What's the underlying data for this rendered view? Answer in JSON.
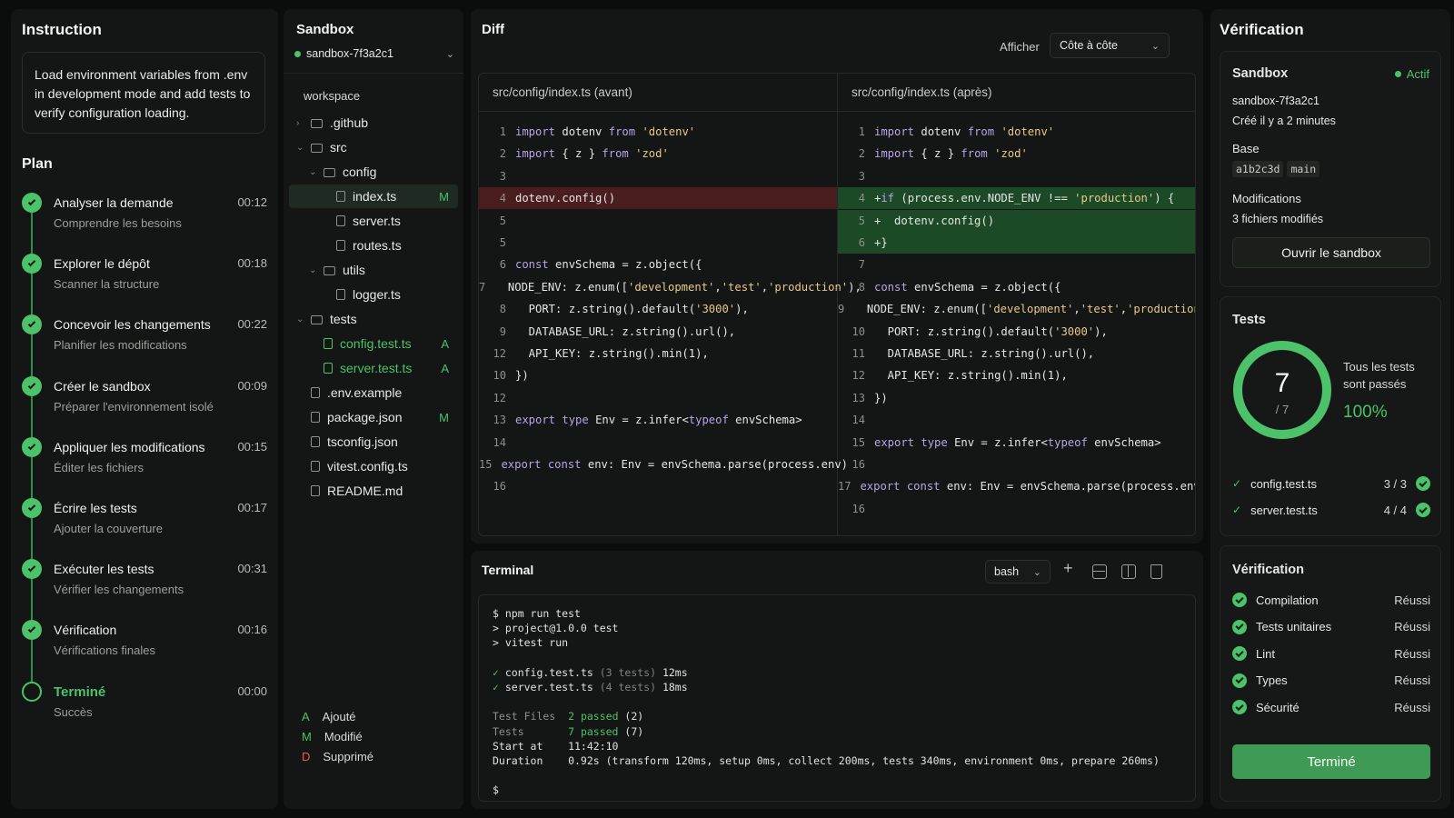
{
  "instruction": {
    "title": "Instruction",
    "text": "Load environment variables from .env in development mode and add tests to verify configuration loading."
  },
  "plan": {
    "title": "Plan",
    "steps": [
      {
        "title": "Analyser la demande",
        "sub": "Comprendre les besoins",
        "time": "00:12"
      },
      {
        "title": "Explorer le dépôt",
        "sub": "Scanner la structure",
        "time": "00:18"
      },
      {
        "title": "Concevoir les changements",
        "sub": "Planifier les modifications",
        "time": "00:22"
      },
      {
        "title": "Créer le sandbox",
        "sub": "Préparer l'environnement isolé",
        "time": "00:09"
      },
      {
        "title": "Appliquer les modifications",
        "sub": "Éditer les fichiers",
        "time": "00:15"
      },
      {
        "title": "Écrire les tests",
        "sub": "Ajouter la couverture",
        "time": "00:17"
      },
      {
        "title": "Exécuter les tests",
        "sub": "Vérifier les changements",
        "time": "00:31"
      },
      {
        "title": "Vérification",
        "sub": "Vérifications finales",
        "time": "00:16"
      },
      {
        "title": "Terminé",
        "sub": "Succès",
        "time": "00:00"
      }
    ]
  },
  "sandbox": {
    "title": "Sandbox",
    "name": "sandbox-7f3a2c1",
    "root": "workspace",
    "tree": [
      {
        "name": ".github",
        "kind": "folder",
        "chev": "›"
      },
      {
        "name": "src",
        "kind": "folder",
        "chev": "⌄"
      },
      {
        "name": "config",
        "kind": "folder",
        "chev": "⌄"
      },
      {
        "name": "index.ts",
        "kind": "file",
        "badge": "M"
      },
      {
        "name": "server.ts",
        "kind": "file"
      },
      {
        "name": "routes.ts",
        "kind": "file"
      },
      {
        "name": "utils",
        "kind": "folder",
        "chev": "⌄"
      },
      {
        "name": "logger.ts",
        "kind": "file"
      },
      {
        "name": "tests",
        "kind": "folder",
        "chev": "⌄"
      },
      {
        "name": "config.test.ts",
        "kind": "file",
        "badge": "A"
      },
      {
        "name": "server.test.ts",
        "kind": "file",
        "badge": "A"
      },
      {
        "name": ".env.example",
        "kind": "file"
      },
      {
        "name": "package.json",
        "kind": "file",
        "badge": "M"
      },
      {
        "name": "tsconfig.json",
        "kind": "file"
      },
      {
        "name": "vitest.config.ts",
        "kind": "file"
      },
      {
        "name": "README.md",
        "kind": "file"
      }
    ],
    "legend": [
      {
        "code": "A",
        "label": "Ajouté"
      },
      {
        "code": "M",
        "label": "Modifié"
      },
      {
        "code": "D",
        "label": "Supprimé"
      }
    ]
  },
  "diff": {
    "title": "Diff",
    "show_label": "Afficher",
    "mode": "Côte à côte",
    "left_file": "src/config/index.ts (avant)",
    "right_file": "src/config/index.ts (après)",
    "left": [
      {
        "n": "1",
        "t": "import dotenv from 'dotenv'"
      },
      {
        "n": "2",
        "t": "import { z } from 'zod'"
      },
      {
        "n": "3",
        "t": ""
      },
      {
        "n": "4",
        "t": "dotenv.config()",
        "k": "del"
      },
      {
        "n": "5",
        "t": ""
      },
      {
        "n": "5",
        "t": ""
      },
      {
        "n": "6",
        "t": "const envSchema = z.object({"
      },
      {
        "n": "7",
        "t": "  NODE_ENV: z.enum(['development','test','production'),"
      },
      {
        "n": "8",
        "t": "  PORT: z.string().default('3000'),"
      },
      {
        "n": "9",
        "t": "  DATABASE_URL: z.string().url(),"
      },
      {
        "n": "12",
        "t": "  API_KEY: z.string().min(1),"
      },
      {
        "n": "10",
        "t": "})"
      },
      {
        "n": "12",
        "t": ""
      },
      {
        "n": "13",
        "t": "export type Env = z.infer<typeof envSchema>"
      },
      {
        "n": "14",
        "t": ""
      },
      {
        "n": "15",
        "t": "export const env: Env = envSchema.parse(process.env)"
      },
      {
        "n": "16",
        "t": ""
      }
    ],
    "right": [
      {
        "n": "1",
        "t": "import dotenv from 'dotenv'"
      },
      {
        "n": "2",
        "t": "import { z } from 'zod'"
      },
      {
        "n": "3",
        "t": ""
      },
      {
        "n": "4",
        "t": "+if (process.env.NODE_ENV !== 'production') {",
        "k": "add"
      },
      {
        "n": "5",
        "t": "+  dotenv.config()",
        "k": "add"
      },
      {
        "n": "6",
        "t": "+}",
        "k": "add"
      },
      {
        "n": "7",
        "t": ""
      },
      {
        "n": "8",
        "t": "const envSchema = z.object({"
      },
      {
        "n": "9",
        "t": "  NODE_ENV: z.enum(['development','test','production'),"
      },
      {
        "n": "10",
        "t": "  PORT: z.string().default('3000'),"
      },
      {
        "n": "11",
        "t": "  DATABASE_URL: z.string().url(),"
      },
      {
        "n": "12",
        "t": "  API_KEY: z.string().min(1),"
      },
      {
        "n": "13",
        "t": "})"
      },
      {
        "n": "14",
        "t": ""
      },
      {
        "n": "15",
        "t": "export type Env = z.infer<typeof envSchema>"
      },
      {
        "n": "16",
        "t": ""
      },
      {
        "n": "17",
        "t": "export const env: Env = envSchema.parse(process.env)"
      },
      {
        "n": "16",
        "t": ""
      }
    ]
  },
  "terminal": {
    "title": "Terminal",
    "shell": "bash",
    "lines": [
      "$ npm run test",
      "> project@1.0.0 test",
      "> vitest run",
      "",
      "✓ config.test.ts (3 tests) 12ms",
      "✓ server.test.ts (4 tests) 18ms",
      "",
      "Test Files  2 passed (2)",
      "Tests       7 passed (7)",
      "Start at    11:42:10",
      "Duration    0.92s (transform 120ms, setup 0ms, collect 200ms, tests 340ms, environment 0ms, prepare 260ms)",
      "",
      "$"
    ]
  },
  "verification": {
    "title": "Vérification",
    "sandbox_card": {
      "title": "Sandbox",
      "status": "Actif",
      "name": "sandbox-7f3a2c1",
      "created": "Créé il y a 2 minutes",
      "base_label": "Base",
      "commit": "a1b2c3d",
      "branch": "main",
      "mods_label": "Modifications",
      "mods_value": "3 fichiers modifiés",
      "open_button": "Ouvrir le sandbox"
    },
    "tests_card": {
      "title": "Tests",
      "passed": 7,
      "total": 7,
      "passed_text": "7",
      "total_text": "/ 7",
      "summary_line1": "Tous les tests",
      "summary_line2": "sont passés",
      "percent": "100%",
      "files": [
        {
          "name": "config.test.ts",
          "score": "3 / 3"
        },
        {
          "name": "server.test.ts",
          "score": "4 / 4"
        }
      ]
    },
    "checks_card": {
      "title": "Vérification",
      "items": [
        {
          "label": "Compilation",
          "status": "Réussi"
        },
        {
          "label": "Tests unitaires",
          "status": "Réussi"
        },
        {
          "label": "Lint",
          "status": "Réussi"
        },
        {
          "label": "Types",
          "status": "Réussi"
        },
        {
          "label": "Sécurité",
          "status": "Réussi"
        }
      ],
      "done_button": "Terminé"
    }
  },
  "colors": {
    "accent": "#4cc26a",
    "removed": "#4a1e1e",
    "added": "#1c4a26"
  }
}
